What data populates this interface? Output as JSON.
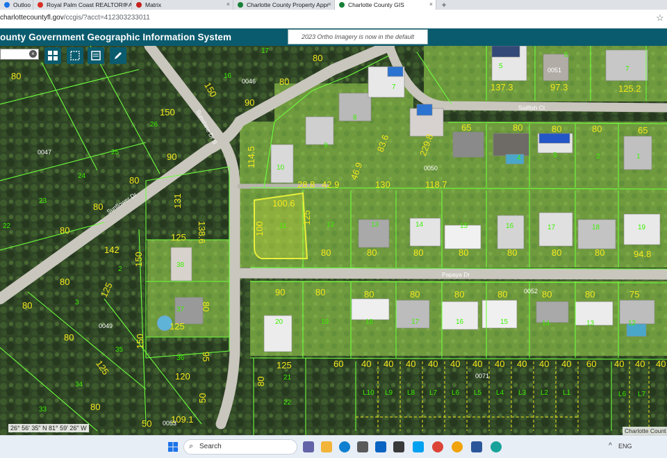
{
  "browser": {
    "tabs": [
      {
        "label": "Outloo",
        "icon": "outlook-icon",
        "color": "#1a73e8",
        "active": false
      },
      {
        "label": "Royal Palm Coast REALTOR® As",
        "icon": "realtor-icon",
        "color": "#d93025",
        "active": false
      },
      {
        "label": "Matrix",
        "icon": "matrix-icon",
        "color": "#c5221f",
        "active": false
      },
      {
        "label": "Charlotte County Property Appr",
        "icon": "property-appraiser-icon",
        "color": "#188038",
        "active": false
      },
      {
        "label": "Charlotte County GIS",
        "icon": "gis-icon",
        "color": "#188038",
        "active": true
      }
    ],
    "new_tab": "+",
    "url_host": "charlottecountyfl.gov",
    "url_path": "/ccgis/?acct=412303233011"
  },
  "app": {
    "title": "ounty Government Geographic Information System",
    "notice": "2023 Ortho Imagery is now in the default basemap",
    "search_close": "×"
  },
  "map": {
    "streets": [
      "Sunshine Dr S",
      "Sunflower Dr",
      "Sailfish Ct",
      "Papaya Dr"
    ],
    "parcel_ids": [
      "0047",
      "0046",
      "0049",
      "0050",
      "0051",
      "0052",
      "0053",
      "0071"
    ],
    "lot_labels": [
      "L10",
      "L9",
      "L8",
      "L7",
      "L6",
      "L5",
      "L4",
      "L3",
      "L2",
      "L1",
      "L6",
      "L7"
    ],
    "coordinates": "26° 56' 35\" N 81° 59' 26\" W",
    "attribution": "Charlotte Count",
    "colors": {
      "parcel_line": "#6dff3b",
      "dimension": "#f4e81c",
      "lot_number": "#3cf000",
      "selected": "#e8f03c"
    }
  },
  "taskbar": {
    "search_placeholder": "Search",
    "language": "ENG"
  }
}
